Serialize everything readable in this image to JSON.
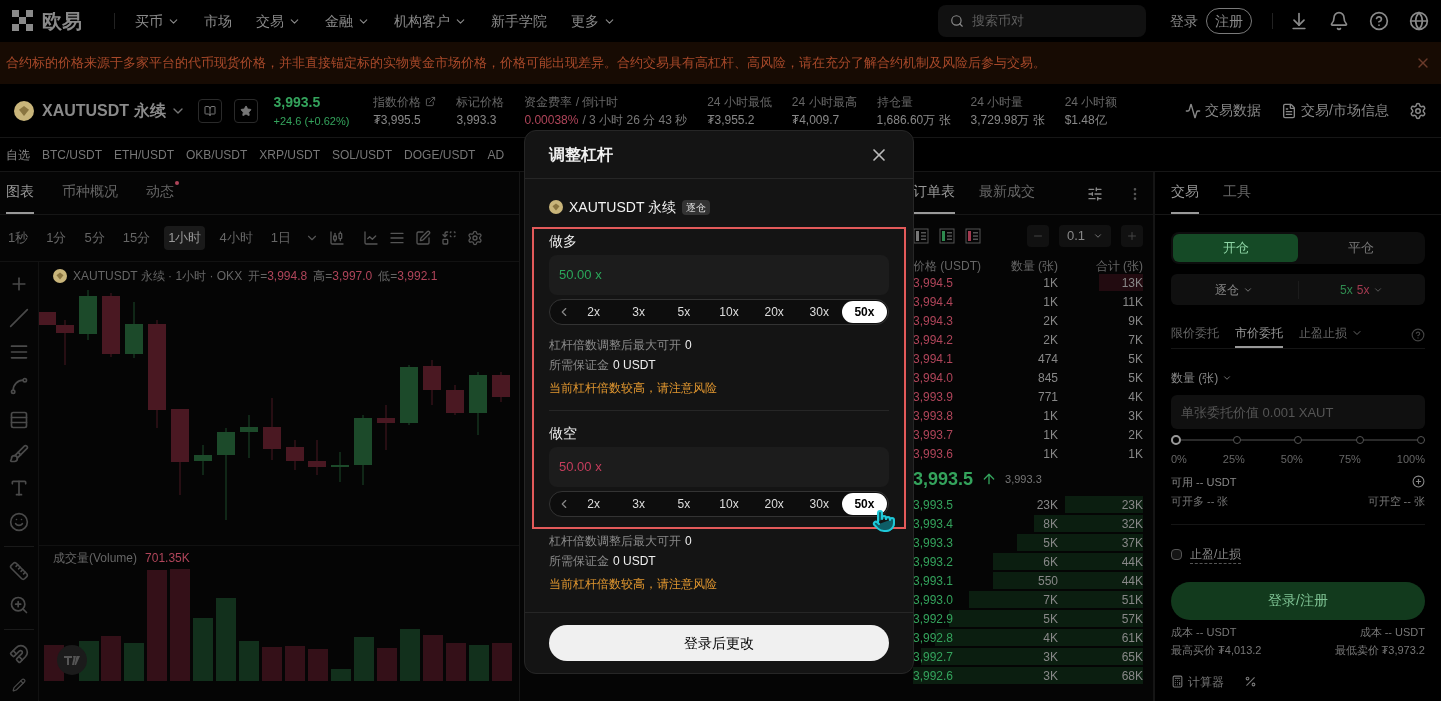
{
  "nav": {
    "brand": "欧易",
    "items": [
      {
        "label": "买币",
        "dropdown": true
      },
      {
        "label": "市场",
        "dropdown": false
      },
      {
        "label": "交易",
        "dropdown": true
      },
      {
        "label": "金融",
        "dropdown": true
      },
      {
        "label": "机构客户",
        "dropdown": true
      },
      {
        "label": "新手学院",
        "dropdown": false
      },
      {
        "label": "更多",
        "dropdown": true
      }
    ],
    "search": {
      "placeholder": "搜索币对"
    },
    "login": "登录",
    "register": "注册"
  },
  "banner": {
    "text": "合约标的价格来源于多家平台的代币现货价格，并非直接锚定标的实物黄金市场价格，价格可能出现差异。合约交易具有高杠杆、高风险，请在充分了解合约机制及风险后参与交易。"
  },
  "ticker": {
    "symbol": "XAUTUSDT 永续",
    "price": "3,993.5",
    "change": "+24.6 (+0.62%)",
    "stats": [
      {
        "label": "指数价格",
        "value": "₮3,995.5",
        "link": true
      },
      {
        "label": "标记价格",
        "value": "3,993.3",
        "link": false
      },
      {
        "label": "资金费率 / 倒计时",
        "value": "0.00038%",
        "extra": "/ 3 小时 26 分 43 秒",
        "link": false
      },
      {
        "label": "24 小时最低",
        "value": "₮3,955.2",
        "link": false
      },
      {
        "label": "24 小时最高",
        "value": "₮4,009.7",
        "link": false
      },
      {
        "label": "持仓量",
        "value": "1,686.60万 张",
        "link": false
      },
      {
        "label": "24 小时量",
        "value": "3,729.98万 张",
        "link": false
      },
      {
        "label": "24 小时额",
        "value": "$1.48亿",
        "link": false
      }
    ],
    "actions": [
      {
        "label": "交易数据",
        "kind": "data"
      },
      {
        "label": "交易/市场信息",
        "kind": "info"
      }
    ]
  },
  "favorites": {
    "label": "自选",
    "pairs": [
      "BTC/USDT",
      "ETH/USDT",
      "OKB/USDT",
      "XRP/USDT",
      "SOL/USDT",
      "DOGE/USDT",
      "AD"
    ]
  },
  "chart": {
    "tabs": [
      {
        "label": "图表",
        "selected": true,
        "badge": false
      },
      {
        "label": "币种概况",
        "selected": false,
        "badge": false
      },
      {
        "label": "动态",
        "selected": false,
        "badge": true
      }
    ],
    "intervals": [
      {
        "label": "1秒",
        "selected": false
      },
      {
        "label": "1分",
        "selected": false
      },
      {
        "label": "5分",
        "selected": false
      },
      {
        "label": "15分",
        "selected": false
      },
      {
        "label": "1小时",
        "selected": true
      },
      {
        "label": "4小时",
        "selected": false
      },
      {
        "label": "1日",
        "selected": false
      }
    ],
    "legend": {
      "title": "XAUTUSDT 永续 · 1小时 · OKX",
      "ohlc": [
        {
          "label": "开=",
          "value": "3,994.8"
        },
        {
          "label": "高=",
          "value": "3,997.0"
        },
        {
          "label": "低=",
          "value": "3,992.1"
        }
      ]
    },
    "volume": {
      "label": "成交量(Volume)",
      "value": "701.35K"
    }
  },
  "order_book": {
    "tabs": [
      {
        "label": "订单表",
        "selected": true
      },
      {
        "label": "最新成交",
        "selected": false
      }
    ],
    "step": "0.1",
    "columns": [
      "价格 (USDT)",
      "数量 (张)",
      "合计 (张)"
    ],
    "asks": [
      {
        "price": "3,994.5",
        "qty": "1K",
        "total": "13K"
      },
      {
        "price": "3,994.4",
        "qty": "1K",
        "total": "11K"
      },
      {
        "price": "3,994.3",
        "qty": "2K",
        "total": "9K"
      },
      {
        "price": "3,994.2",
        "qty": "2K",
        "total": "7K"
      },
      {
        "price": "3,994.1",
        "qty": "474",
        "total": "5K"
      },
      {
        "price": "3,994.0",
        "qty": "845",
        "total": "5K"
      },
      {
        "price": "3,993.9",
        "qty": "771",
        "total": "4K"
      },
      {
        "price": "3,993.8",
        "qty": "1K",
        "total": "3K"
      },
      {
        "price": "3,993.7",
        "qty": "1K",
        "total": "2K"
      },
      {
        "price": "3,993.6",
        "qty": "1K",
        "total": "1K"
      }
    ],
    "mid": {
      "price": "3,993.5",
      "mark": "3,993.3"
    },
    "bids": [
      {
        "price": "3,993.5",
        "qty": "23K",
        "total": "23K"
      },
      {
        "price": "3,993.4",
        "qty": "8K",
        "total": "32K"
      },
      {
        "price": "3,993.3",
        "qty": "5K",
        "total": "37K"
      },
      {
        "price": "3,993.2",
        "qty": "6K",
        "total": "44K"
      },
      {
        "price": "3,993.1",
        "qty": "550",
        "total": "44K"
      },
      {
        "price": "3,993.0",
        "qty": "7K",
        "total": "51K"
      },
      {
        "price": "3,992.9",
        "qty": "5K",
        "total": "57K"
      },
      {
        "price": "3,992.8",
        "qty": "4K",
        "total": "61K"
      },
      {
        "price": "3,992.7",
        "qty": "3K",
        "total": "65K"
      },
      {
        "price": "3,992.6",
        "qty": "3K",
        "total": "68K"
      }
    ]
  },
  "trade": {
    "tabs": [
      {
        "label": "交易",
        "selected": true
      },
      {
        "label": "工具",
        "selected": false
      }
    ],
    "modes": [
      {
        "label": "开仓",
        "selected": true
      },
      {
        "label": "平仓",
        "selected": false
      }
    ],
    "margin_mode": "逐仓",
    "leverage": [
      {
        "kind": "long",
        "value": "5x"
      },
      {
        "kind": "short",
        "value": "5x"
      }
    ],
    "order_types": [
      {
        "label": "限价委托",
        "selected": false,
        "dropdown": false
      },
      {
        "label": "市价委托",
        "selected": true,
        "dropdown": false
      },
      {
        "label": "止盈止损",
        "selected": false,
        "dropdown": true
      }
    ],
    "quantity": {
      "label": "数量 (张)",
      "placeholder": "单张委托价值 0.001 XAUT"
    },
    "slider": {
      "level": 0,
      "ticks": [
        "0%",
        "25%",
        "50%",
        "75%",
        "100%"
      ]
    },
    "available": "可用 -- USDT",
    "max_long": "可开多 -- 张",
    "max_short": "可开空 -- 张",
    "tpsl": {
      "label": "止盈/止损",
      "checked": false
    },
    "submit": "登录/注册",
    "costs": [
      "成本 -- USDT",
      "成本 -- USDT"
    ],
    "prices": [
      "最高买价 ₮4,013.2",
      "最低卖价 ₮3,973.2"
    ],
    "calculator": "计算器"
  },
  "modal": {
    "title": "调整杠杆",
    "symbol": "XAUTUSDT 永续",
    "margin_tag": "逐仓",
    "sections": [
      {
        "kind": "long",
        "label": "做多",
        "value": "50.00 x",
        "options": [
          {
            "label": "2x",
            "selected": false
          },
          {
            "label": "3x",
            "selected": false
          },
          {
            "label": "5x",
            "selected": false
          },
          {
            "label": "10x",
            "selected": false
          },
          {
            "label": "20x",
            "selected": false
          },
          {
            "label": "30x",
            "selected": false
          },
          {
            "label": "50x",
            "selected": true
          }
        ],
        "max_open": {
          "label": "杠杆倍数调整后最大可开",
          "value": "0"
        },
        "margin": {
          "label": "所需保证金",
          "value": "0 USDT"
        },
        "warning": "当前杠杆倍数较高，请注意风险"
      },
      {
        "kind": "short",
        "label": "做空",
        "value": "50.00 x",
        "options": [
          {
            "label": "2x",
            "selected": false
          },
          {
            "label": "3x",
            "selected": false
          },
          {
            "label": "5x",
            "selected": false
          },
          {
            "label": "10x",
            "selected": false
          },
          {
            "label": "20x",
            "selected": false
          },
          {
            "label": "30x",
            "selected": false
          },
          {
            "label": "50x",
            "selected": true
          }
        ],
        "max_open": {
          "label": "杠杆倍数调整后最大可开",
          "value": "0"
        },
        "margin": {
          "label": "所需保证金",
          "value": "0 USDT"
        },
        "warning": "当前杠杆倍数较高，请注意风险"
      }
    ],
    "confirm": "登录后更改"
  }
}
